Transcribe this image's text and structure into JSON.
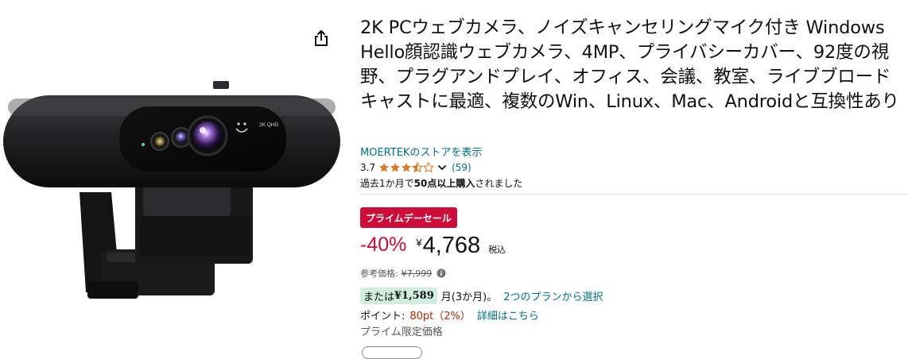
{
  "title": "2K PCウェブカメラ、ノイズキャンセリングマイク付き Windows Hello顔認識ウェブカメラ、4MP、プライバシーカバー、92度の視野、プラグアンドプレイ、オフィス、会議、教室、ライブブロードキャストに最適、複数のWin、Linux、Mac、Androidと互換性あり",
  "store_link": "MOERTEKのストアを表示",
  "rating": {
    "value": "3.7",
    "stars": 3.7,
    "count": "(59)"
  },
  "purchase_note": {
    "prefix": "過去1か月で",
    "bold": "50点以上購入",
    "suffix": "されました"
  },
  "deal_badge": "プライムデーセール",
  "price": {
    "discount": "-40%",
    "currency": "¥",
    "amount": "4,768",
    "tax": "税込"
  },
  "reference": {
    "label": "参考価格:",
    "value": "¥7,999"
  },
  "installment": {
    "prefix": "または",
    "amount": "¥1,589",
    "term": "月(3か月)。",
    "link": "2つのプランから選択"
  },
  "points": {
    "label": "ポイント:",
    "value": "80pt（2%）",
    "link": "詳細はこちら"
  },
  "prime_note": "プライム限定価格",
  "product_image": {
    "lens_label": "2K QHD"
  },
  "colors": {
    "link": "#007185",
    "deal": "#cc0c39",
    "star": "#de7921",
    "installment_bg": "#cfeee0"
  },
  "icons": [
    "share-icon",
    "star-icon",
    "chevron-down-icon",
    "info-icon"
  ]
}
